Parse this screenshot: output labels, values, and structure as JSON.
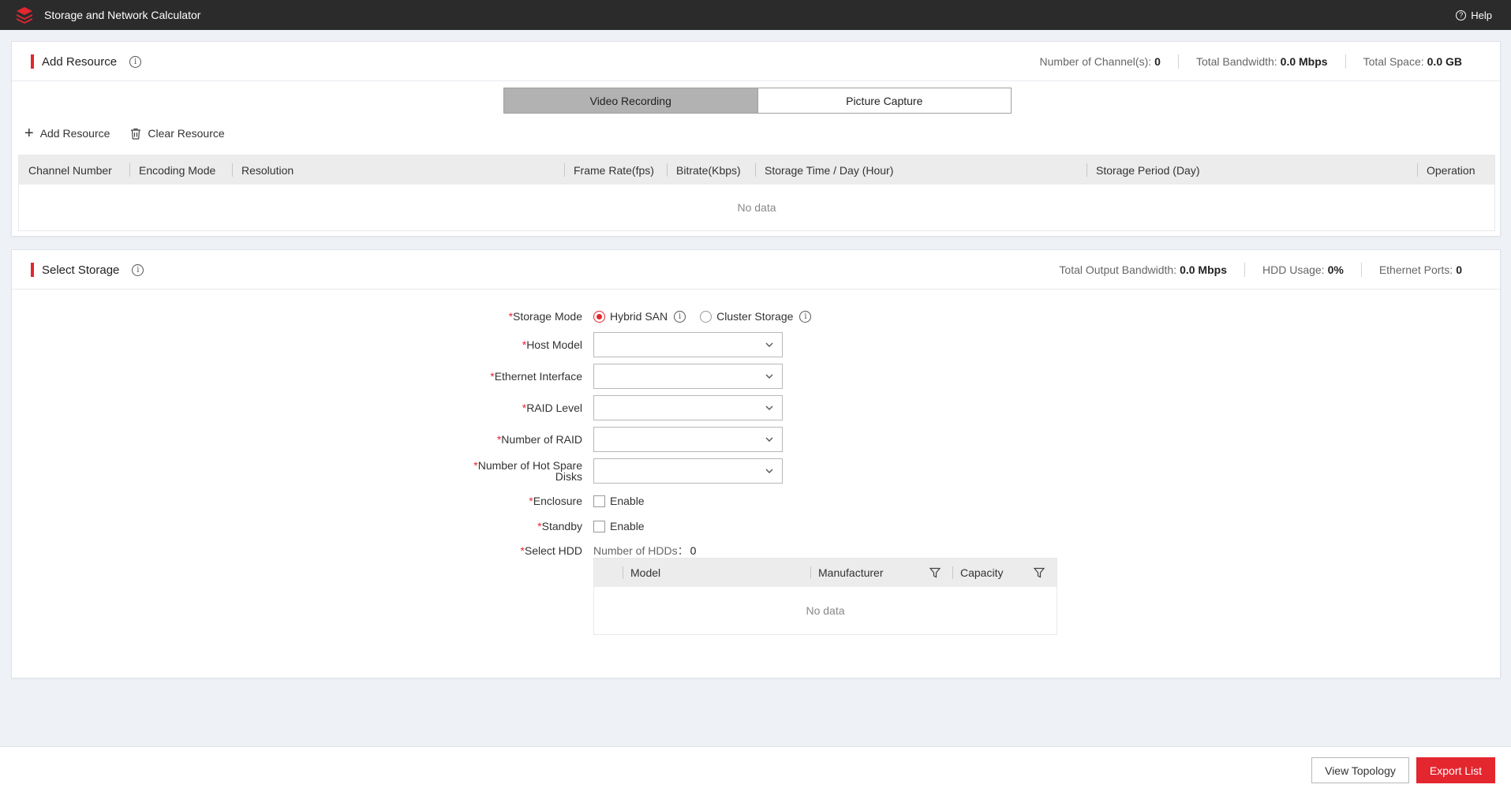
{
  "app": {
    "title": "Storage and Network Calculator",
    "help_label": "Help"
  },
  "add_resource": {
    "title": "Add Resource",
    "stats": [
      {
        "label": "Number of Channel(s):",
        "value": "0"
      },
      {
        "label": "Total Bandwidth:",
        "value": "0.0 Mbps"
      },
      {
        "label": "Total Space:",
        "value": "0.0 GB"
      }
    ],
    "tabs": [
      {
        "label": "Video Recording",
        "active": true
      },
      {
        "label": "Picture Capture",
        "active": false
      }
    ],
    "actions": {
      "add": "Add Resource",
      "clear": "Clear Resource"
    },
    "columns": [
      "Channel Number",
      "Encoding Mode",
      "Resolution",
      "Frame Rate(fps)",
      "Bitrate(Kbps)",
      "Storage Time / Day (Hour)",
      "Storage Period (Day)",
      "Operation"
    ],
    "empty_text": "No data"
  },
  "select_storage": {
    "title": "Select Storage",
    "stats": [
      {
        "label": "Total Output Bandwidth:",
        "value": "0.0 Mbps"
      },
      {
        "label": "HDD Usage:",
        "value": "0%"
      },
      {
        "label": "Ethernet Ports:",
        "value": "0"
      }
    ],
    "form": {
      "storage_mode": {
        "label": "Storage Mode",
        "options": [
          {
            "label": "Hybrid SAN",
            "selected": true
          },
          {
            "label": "Cluster Storage",
            "selected": false
          }
        ]
      },
      "host_model": {
        "label": "Host Model",
        "value": ""
      },
      "ethernet_interface": {
        "label": "Ethernet Interface",
        "value": ""
      },
      "raid_level": {
        "label": "RAID Level",
        "value": ""
      },
      "number_of_raid": {
        "label": "Number of RAID",
        "value": ""
      },
      "hot_spare": {
        "label_line1": "Number of Hot Spare",
        "label_line2": "Disks",
        "value": ""
      },
      "enclosure": {
        "label": "Enclosure",
        "checkbox_label": "Enable",
        "checked": false
      },
      "standby": {
        "label": "Standby",
        "checkbox_label": "Enable",
        "checked": false
      },
      "select_hdd": {
        "label": "Select HDD",
        "count_label": "Number of HDDs：",
        "count_value": "0"
      },
      "required_mark": "*"
    },
    "hdd_columns": [
      "Model",
      "Manufacturer",
      "Capacity"
    ],
    "empty_text": "No data"
  },
  "footer": {
    "view_topology": "View Topology",
    "export_list": "Export List"
  },
  "colors": {
    "accent": "#e4262f",
    "topbar": "#2b2b2b",
    "background": "#eef1f6"
  }
}
